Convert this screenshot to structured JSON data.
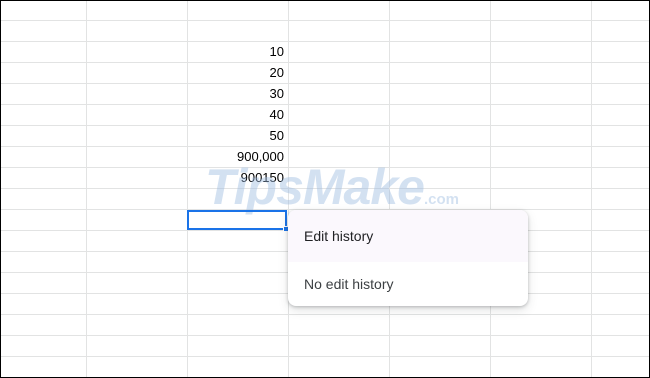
{
  "sheet": {
    "column_c_values": [
      "10",
      "20",
      "30",
      "40",
      "50",
      "900,000",
      "900150"
    ]
  },
  "popup": {
    "title": "Edit history",
    "message": "No edit history"
  },
  "watermark": {
    "text": "TipsMake",
    "suffix": ".com"
  }
}
